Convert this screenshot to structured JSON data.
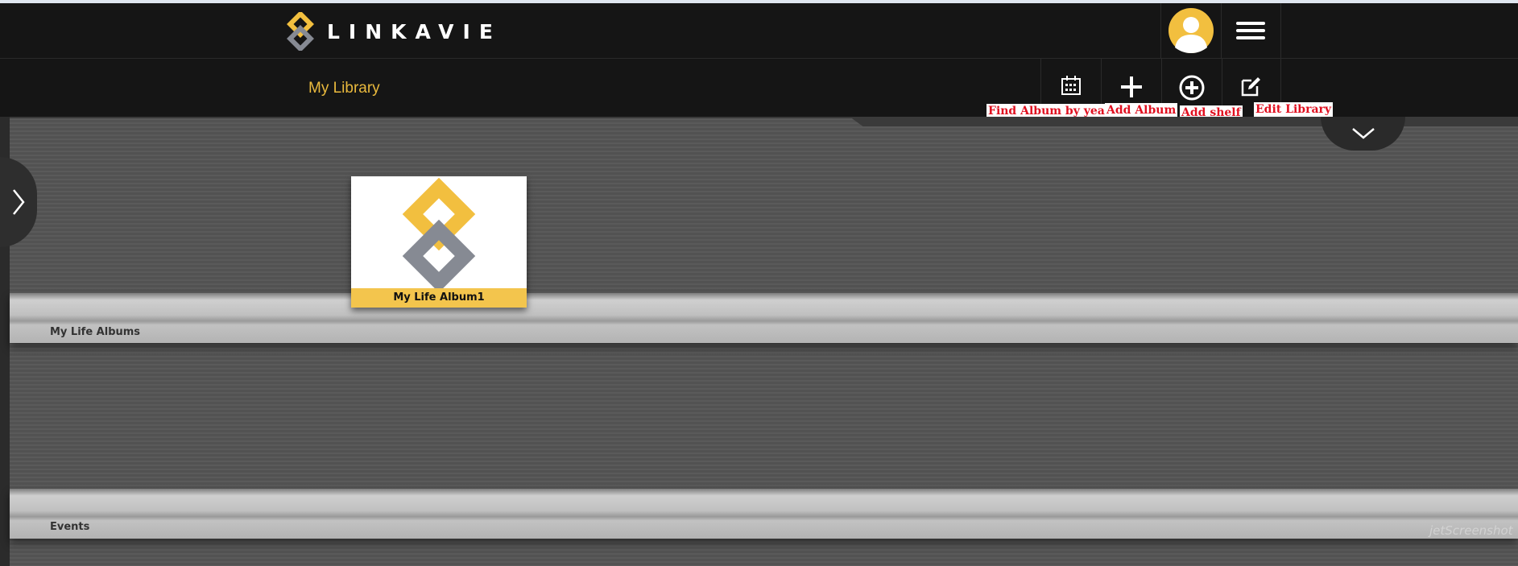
{
  "app": {
    "logo_text": "LINKAVIE"
  },
  "header": {
    "page_title": "My Library"
  },
  "toolbar": {
    "find_album_label": "Find Album by year",
    "add_album_label": "Add Album",
    "add_shelf_label": "Add shelf",
    "edit_library_label": "Edit Library"
  },
  "shelves": [
    {
      "label": "My Life Albums",
      "albums": [
        {
          "caption": "My Life Album1"
        }
      ]
    },
    {
      "label": "Events",
      "albums": []
    }
  ],
  "watermark": "jetScreenshot",
  "colors": {
    "accent": "#e9b93d",
    "logo_yellow": "#f2bf3f",
    "logo_gray": "#868a93",
    "header_bg": "#151515",
    "annotation_text": "#e01020"
  },
  "icons": [
    "linkavie-logo-icon",
    "user-avatar-icon",
    "hamburger-menu-icon",
    "calendar-icon",
    "plus-icon",
    "plus-circle-icon",
    "edit-icon",
    "chevron-right-icon",
    "chevron-down-icon"
  ]
}
